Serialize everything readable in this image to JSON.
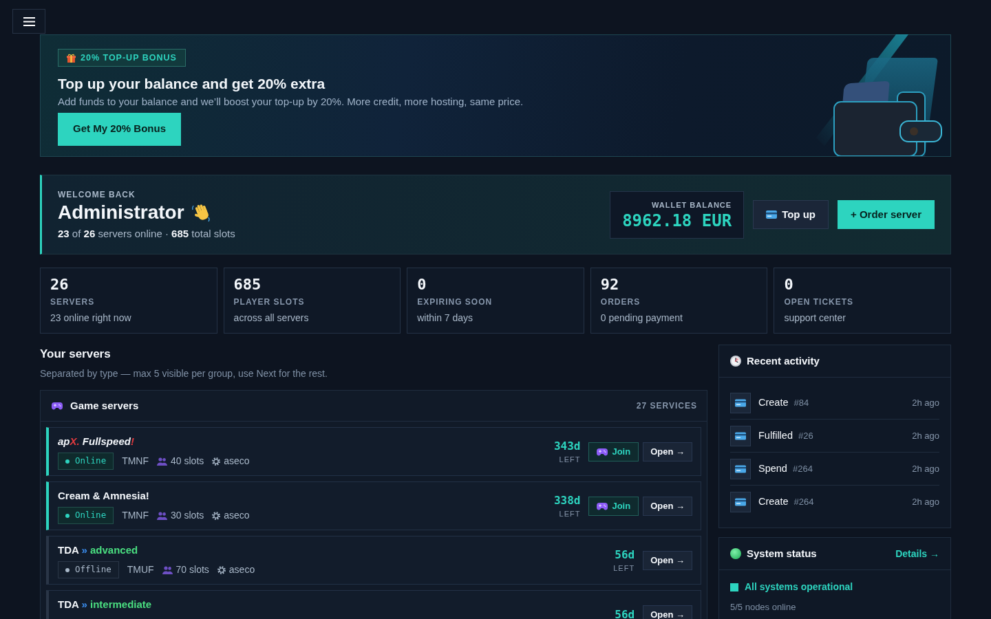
{
  "promo": {
    "badge": "20% TOP-UP BONUS",
    "title": "Top up your balance and get 20% extra",
    "text": "Add funds to your balance and we’ll boost your top-up by 20%. More credit, more hosting, same price.",
    "button": "Get My 20% Bonus"
  },
  "welcome": {
    "eyebrow": "WELCOME BACK",
    "name": "Administrator",
    "summary": "**23** of **26** servers online · **685** total slots",
    "wallet": {
      "label": "WALLET BALANCE",
      "amount": "8962.18 EUR"
    },
    "buttons": [
      {
        "label": "Top up",
        "kind": "topup"
      },
      {
        "label": "+ Order server",
        "kind": "order"
      }
    ]
  },
  "stats": [
    {
      "value": "26",
      "label": "SERVERS",
      "note": "23 online right now"
    },
    {
      "value": "685",
      "label": "PLAYER SLOTS",
      "note": "across all servers"
    },
    {
      "value": "0",
      "label": "EXPIRING SOON",
      "note": "within 7 days"
    },
    {
      "value": "92",
      "label": "ORDERS",
      "note": "0 pending payment"
    },
    {
      "value": "0",
      "label": "OPEN TICKETS",
      "note": "support center"
    }
  ],
  "servers": {
    "title": "Your servers",
    "subtitle": "Separated by type — max 5 visible per group, use Next for the rest.",
    "groups": [
      {
        "title": "Game servers",
        "count": "27 SERVICES",
        "rows": [
          {
            "name": [
              {
                "text": "ap"
              },
              {
                "text": "X.",
                "color": "#e23a3f"
              },
              {
                "text": " Fullspeed"
              },
              {
                "text": "!",
                "color": "#e23a3f"
              }
            ],
            "italic": true,
            "online": true,
            "status": "Online",
            "game": "TMNF",
            "slots": "40 slots",
            "panel": "aseco",
            "days": "343d",
            "days_label": "LEFT",
            "join": "Join",
            "open": "Open →"
          },
          {
            "name": [
              {
                "text": "Cream & Amnesia!"
              }
            ],
            "italic": false,
            "online": true,
            "status": "Online",
            "game": "TMNF",
            "slots": "30 slots",
            "panel": "aseco",
            "days": "338d",
            "days_label": "LEFT",
            "join": "Join",
            "open": "Open →"
          },
          {
            "name": [
              {
                "text": "TDA "
              },
              {
                "text": "»",
                "color": "#3b8ef0"
              },
              {
                "text": " advanced",
                "color": "#4ade80"
              }
            ],
            "italic": false,
            "online": false,
            "status": "Offline",
            "game": "TMUF",
            "slots": "70 slots",
            "panel": "aseco",
            "days": "56d",
            "days_label": "LEFT",
            "open": "Open →"
          },
          {
            "name": [
              {
                "text": "TDA "
              },
              {
                "text": "»",
                "color": "#3b8ef0"
              },
              {
                "text": " intermediate",
                "color": "#4ade80"
              }
            ],
            "italic": false,
            "online": false,
            "days": "56d",
            "open": "Open →"
          }
        ]
      }
    ]
  },
  "activity": {
    "title": "Recent activity",
    "items": [
      {
        "action": "Create",
        "ref": "#84",
        "time": "2h ago"
      },
      {
        "action": "Fulfilled",
        "ref": "#26",
        "time": "2h ago"
      },
      {
        "action": "Spend",
        "ref": "#264",
        "time": "2h ago"
      },
      {
        "action": "Create",
        "ref": "#264",
        "time": "2h ago"
      }
    ]
  },
  "system_status": {
    "title": "System status",
    "link": "Details →",
    "message": "All systems operational",
    "detail": "5/5 nodes online"
  }
}
